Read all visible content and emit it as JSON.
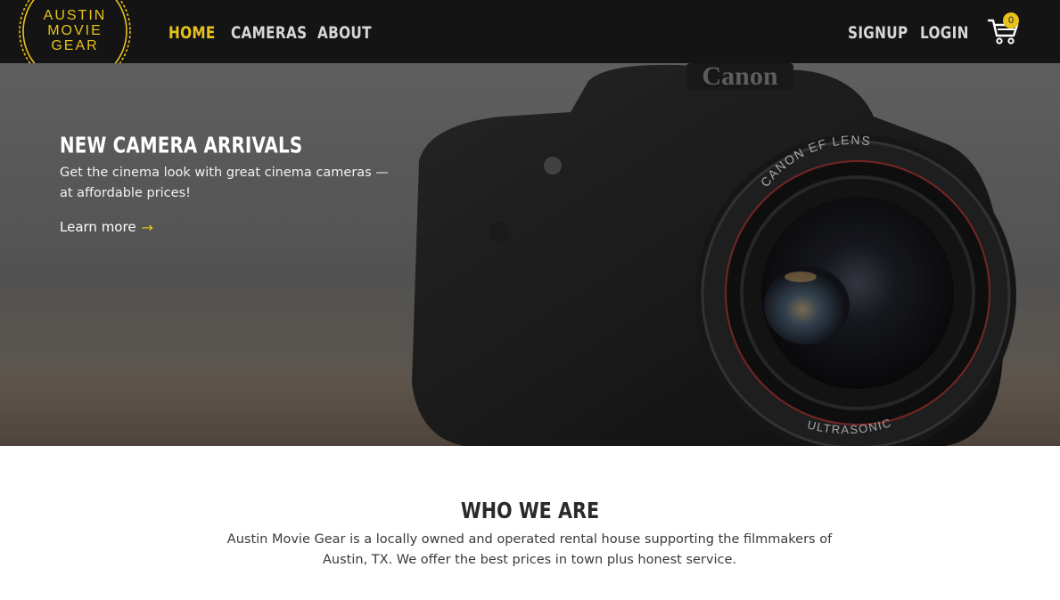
{
  "logo": {
    "line1": "AUSTIN",
    "line2": "MOVIE",
    "line3": "GEAR"
  },
  "nav": {
    "links": [
      {
        "label": "HOME",
        "active": true
      },
      {
        "label": "CAMERAS",
        "active": false
      },
      {
        "label": "ABOUT",
        "active": false
      }
    ],
    "auth": {
      "signup": "SIGNUP",
      "login": "LOGIN"
    },
    "cart": {
      "count": "0",
      "icon": "cart-icon"
    }
  },
  "hero": {
    "title": "NEW CAMERA ARRIVALS",
    "text": "Get the cinema look with great cinema cameras — at affordable prices!",
    "link_label": "Learn more",
    "link_arrow": "→",
    "lens_text_top": "CANON EF  LENS",
    "lens_text_bottom": "ULTRASONIC",
    "body_brand": "Canon"
  },
  "about": {
    "title": "WHO WE ARE",
    "text": "Austin Movie Gear is a locally owned and operated rental house supporting the filmmakers of Austin, TX. We offer the best prices in town plus honest service."
  },
  "colors": {
    "accent": "#e7c21c",
    "nav_bg": "#141414",
    "nav_text": "#d7d7d7",
    "heading": "#2a2a2a"
  }
}
